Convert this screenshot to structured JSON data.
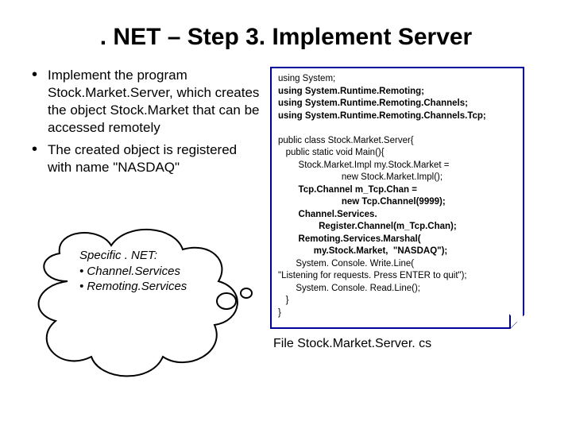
{
  "title": ". NET – Step 3. Implement Server",
  "bullets": [
    "Implement the program Stock.Market.Server, which creates the  object Stock.Market that can be accessed remotely",
    "The created object is registered with name \"NASDAQ\""
  ],
  "cloud": {
    "heading": "Specific . NET:",
    "item1": "• Channel.Services",
    "item2": "• Remoting.Services"
  },
  "code": {
    "l1": "using System;",
    "l2": "using System.Runtime.Remoting;",
    "l3": "using System.Runtime.Remoting.Channels;",
    "l4": "using System.Runtime.Remoting.Channels.Tcp;",
    "l5": "",
    "l6": "public class Stock.Market.Server{",
    "l7": "   public static void Main(){",
    "l8a": "        Stock.Market.Impl my.Stock.Market =",
    "l8b": "                         new Stock.Market.Impl();",
    "l9a": "        Tcp.Channel m_Tcp.Chan =",
    "l9b": "                         new Tcp.Channel(9999);",
    "l10a": "        Channel.Services.",
    "l10b": "                Register.Channel(m_Tcp.Chan);",
    "l11a": "        Remoting.Services.Marshal(",
    "l11b": "              my.Stock.Market,  \"NASDAQ\");",
    "l12a": "       System. Console. Write.Line(",
    "l12b": "\"Listening for requests. Press ENTER to quit\");",
    "l13": "       System. Console. Read.Line();",
    "l14": "   }",
    "l15": "}"
  },
  "file_caption": "File Stock.Market.Server. cs"
}
